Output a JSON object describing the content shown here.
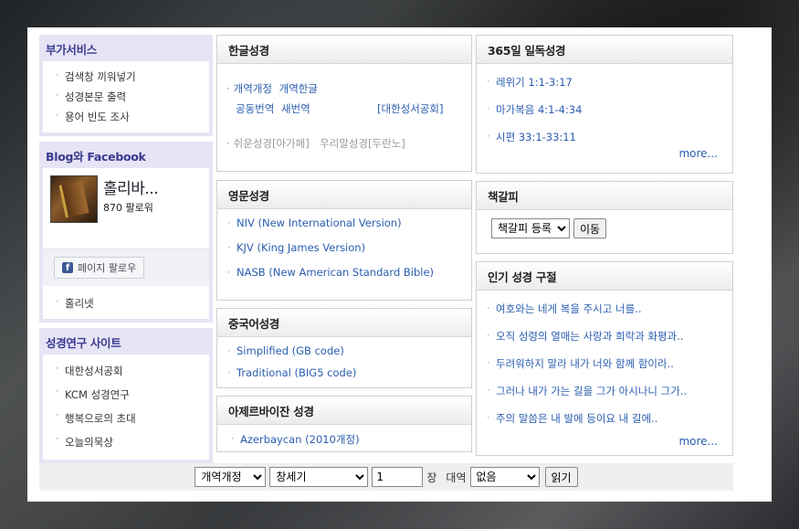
{
  "sidebar": {
    "extra_services": {
      "title": "부가서비스",
      "items": [
        "검색창 끼워넣기",
        "성경본문 출력",
        "용어 빈도 조사"
      ]
    },
    "social": {
      "title": "Blog와 Facebook",
      "fb_name": "홀리바...",
      "fb_followers": "870 팔로워",
      "follow_button": "페이지 팔로우",
      "items": [
        "홀리넷"
      ]
    },
    "study_sites": {
      "title": "성경연구 사이트",
      "items": [
        "대한성서공회",
        "KCM 성경연구",
        "행복으로의 초대",
        "오늘의묵상"
      ]
    }
  },
  "korean_bible": {
    "title": "한글성경",
    "row1": [
      "개역개정",
      "개역한글"
    ],
    "row2": [
      "공동번역",
      "새번역"
    ],
    "publisher": "[대한성서공회]",
    "row3": [
      "쉬운성경[아가페]",
      "우리말성경[두란노]"
    ]
  },
  "english_bible": {
    "title": "영문성경",
    "items": [
      "NIV (New International Version)",
      "KJV (King James Version)",
      "NASB (New American Standard Bible)"
    ]
  },
  "chinese_bible": {
    "title": "중국어성경",
    "items": [
      "Simplified (GB code)",
      "Traditional (BIG5 code)"
    ]
  },
  "azerbaijani_bible": {
    "title": "아제르바이잔 성경",
    "items": [
      "Azerbaycan (2010개정)"
    ]
  },
  "reading_plan": {
    "title": "365일 일독성경",
    "items": [
      "레위기 1:1-3:17",
      "마가복음 4:1-4:34",
      "시편 33:1-33:11"
    ],
    "more": "more..."
  },
  "bookmark": {
    "title": "책갈피",
    "select_value": "책갈피 등록",
    "go_button": "이동"
  },
  "popular_verses": {
    "title": "인기 성경 구절",
    "items": [
      "여호와는 네게 복을 주시고 너를..",
      "오직 성령의 열매는 사랑과 희락과 화평과..",
      "두려워하지 말라 내가 너와 함께 함이라..",
      "그러나 내가 가는 길을 그가 아시나니 그가..",
      "주의 말씀은 내 발에 등이요 내 길에.."
    ],
    "more": "more..."
  },
  "bottom_bar": {
    "version_select": "개역개정",
    "book_select": "창세기",
    "chapter_value": "1",
    "chapter_label": "장",
    "parallel_label": "대역",
    "parallel_select": "없음",
    "read_button": "읽기"
  }
}
